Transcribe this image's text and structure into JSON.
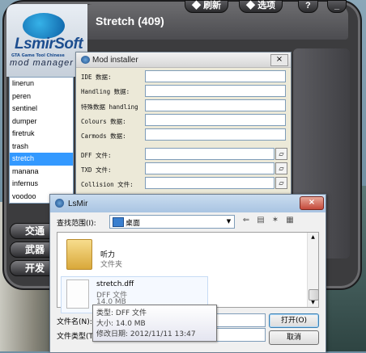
{
  "app": {
    "title": "Stretch (409)",
    "tabs": [
      "刷新",
      "选项",
      "?",
      "_"
    ],
    "logo": {
      "brand": "LsmirSoft",
      "subtitle": "GTA Game Tool Chinese",
      "product": "mod manager"
    }
  },
  "vehicle_list": {
    "items": [
      "linerun",
      "peren",
      "sentinel",
      "dumper",
      "firetruk",
      "trash",
      "stretch",
      "manana",
      "infernus",
      "voodoo"
    ],
    "selected": "stretch"
  },
  "side_buttons": [
    "交通",
    "武器",
    "开发"
  ],
  "mod_installer": {
    "title": "Mod installer",
    "close": "×",
    "fields": [
      {
        "label": "IDE 数据:",
        "type": "text"
      },
      {
        "label": "Handling 数据:",
        "type": "text"
      },
      {
        "label": "特殊数据 handling",
        "type": "text"
      },
      {
        "label": "Colours 数据:",
        "type": "text"
      },
      {
        "label": "Carmods 数据:",
        "type": "text"
      },
      {
        "label": "DFF 文件:",
        "type": "file"
      },
      {
        "label": "TXD 文件:",
        "type": "file"
      },
      {
        "label": "Collision 文件:",
        "type": "file"
      }
    ]
  },
  "file_dialog": {
    "title": "LsMir",
    "close": "×",
    "look_in_label": "查找范围(I):",
    "look_in_value": "桌面",
    "items": [
      {
        "name": "听力",
        "type": "文件夹"
      },
      {
        "name": "stretch.dff",
        "type": "DFF 文件",
        "size": "14.0 MB"
      }
    ],
    "filename_label": "文件名(N):",
    "filetype_label": "文件类型(T):",
    "open_label": "打开(O)",
    "cancel_label": "取消"
  },
  "tooltip": {
    "type": "类型: DFF 文件",
    "size": "大小: 14.0 MB",
    "modified": "修改日期: 2012/11/11 13:47"
  }
}
